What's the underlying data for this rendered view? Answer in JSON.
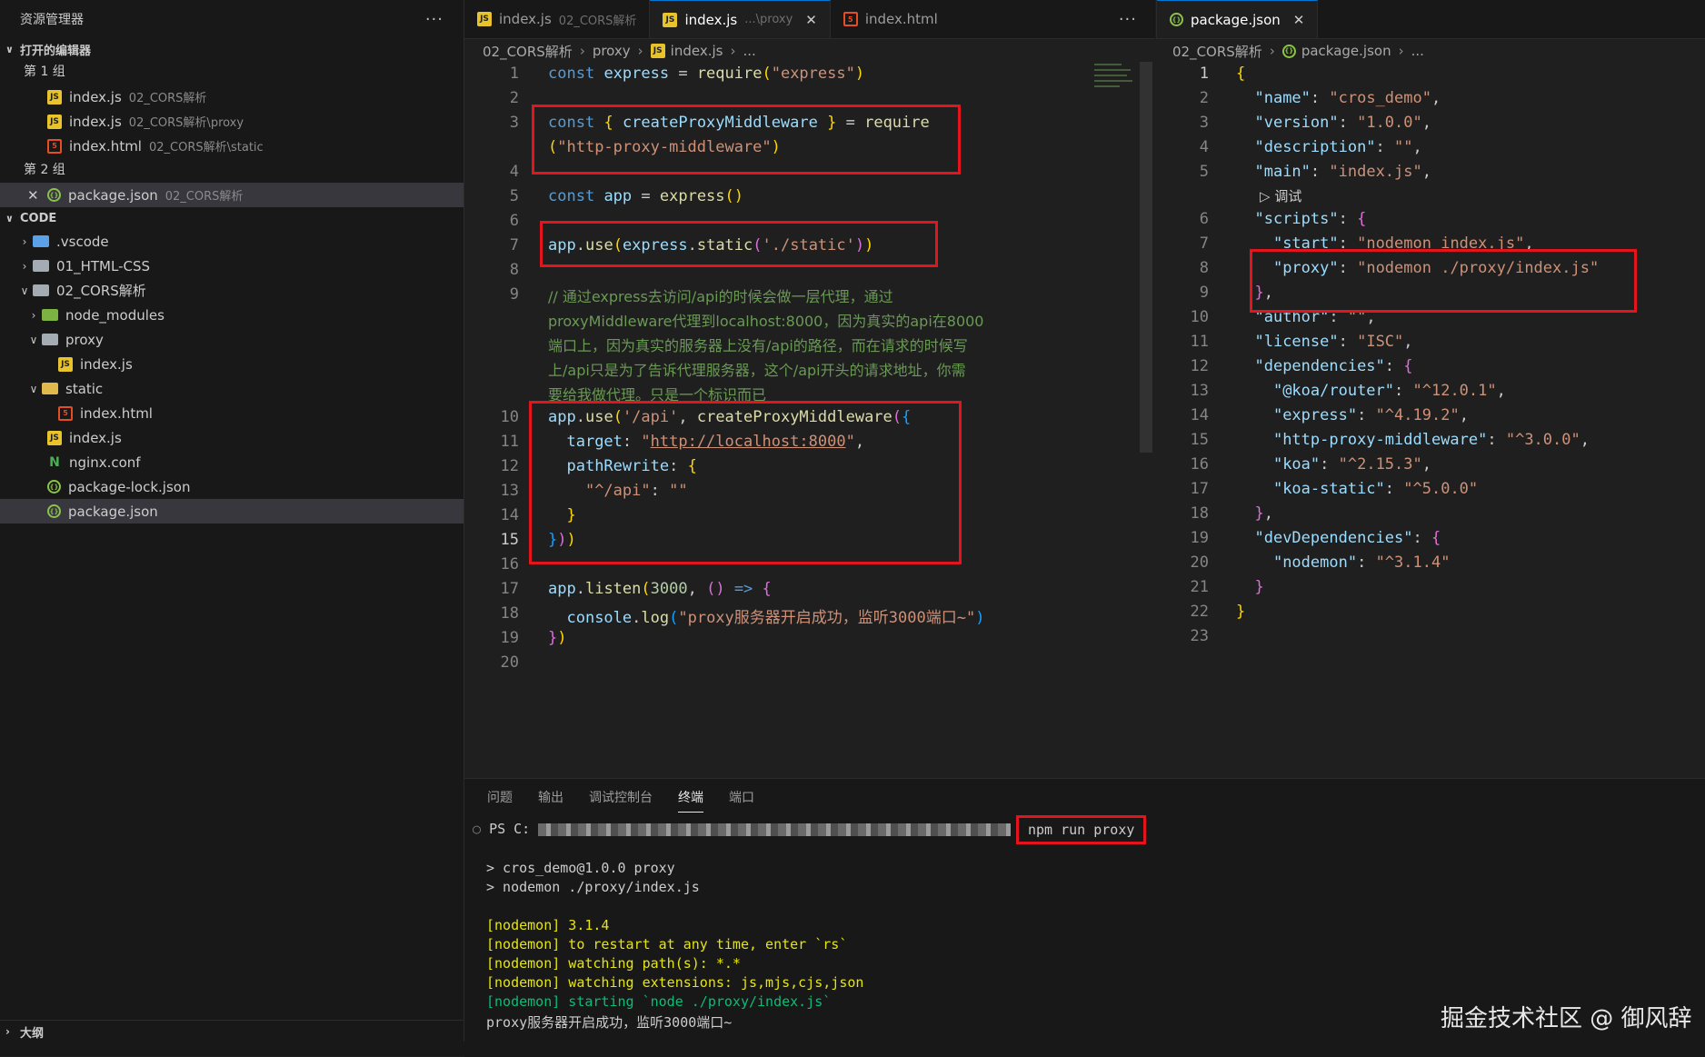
{
  "explorer": {
    "title": "资源管理器",
    "more": "···",
    "open_editors": {
      "header": "打开的编辑器",
      "group1_label": "第 1 组",
      "group1_items": [
        {
          "name": "index.js",
          "desc": "02_CORS解析",
          "icon": "js-file-icon"
        },
        {
          "name": "index.js",
          "desc": "02_CORS解析\\proxy",
          "icon": "js-file-icon"
        },
        {
          "name": "index.html",
          "desc": "02_CORS解析\\static",
          "icon": "html-file-icon"
        }
      ],
      "group2_label": "第 2 组",
      "group2_items": [
        {
          "name": "package.json",
          "desc": "02_CORS解析",
          "icon": "json-file-icon"
        }
      ]
    },
    "workspace": {
      "header": "CODE",
      "tree": [
        {
          "label": ".vscode"
        },
        {
          "label": "01_HTML-CSS"
        },
        {
          "label": "02_CORS解析"
        },
        {
          "label": "node_modules"
        },
        {
          "label": "proxy"
        },
        {
          "label": "index.js"
        },
        {
          "label": "static"
        },
        {
          "label": "index.html"
        },
        {
          "label": "index.js"
        },
        {
          "label": "nginx.conf"
        },
        {
          "label": "package-lock.json"
        },
        {
          "label": "package.json"
        }
      ]
    },
    "outline_header": "大纲"
  },
  "left_editor": {
    "tabs": [
      {
        "name": "index.js",
        "desc": "02_CORS解析"
      },
      {
        "name": "index.js",
        "desc": "...\\proxy",
        "close": "✕"
      },
      {
        "name": "index.html",
        "desc": ""
      }
    ],
    "more": "···",
    "breadcrumb": [
      "02_CORS解析",
      "proxy",
      "index.js",
      "..."
    ],
    "line_numbers": [
      "1",
      "2",
      "3",
      "4",
      "5",
      "6",
      "7",
      "8",
      "9",
      "10",
      "11",
      "12",
      "13",
      "14",
      "15",
      "16",
      "17",
      "18",
      "19",
      "20"
    ],
    "comment_lines": [
      "// 通过express去访问/api的时候会做一层代理，通过",
      "proxyMiddleware代理到localhost:8000，因为真实的api在8000",
      "端口上，因为真实的服务器上没有/api的路径，而在请求的时候写",
      "上/api只是为了告诉代理服务器，这个/api开头的请求地址，你需",
      "要给我做代理。只是一个标识而已"
    ],
    "url": "http://localhost:8000"
  },
  "right_editor": {
    "tab": {
      "name": "package.json",
      "close": "✕"
    },
    "breadcrumb": [
      "02_CORS解析",
      "package.json",
      "..."
    ],
    "debug_label": "调试",
    "line_numbers": [
      "1",
      "2",
      "3",
      "4",
      "5",
      "6",
      "7",
      "8",
      "9",
      "10",
      "11",
      "12",
      "13",
      "14",
      "15",
      "16",
      "17",
      "18",
      "19",
      "20",
      "21",
      "22",
      "23"
    ]
  },
  "panel": {
    "tabs": [
      "问题",
      "输出",
      "调试控制台",
      "终端",
      "端口"
    ],
    "active_tab": "终端",
    "prompt": "PS C:",
    "command": "npm run proxy",
    "output": [
      {
        "text": "> cros_demo@1.0.0 proxy",
        "color": "white"
      },
      {
        "text": "> nodemon ./proxy/index.js",
        "color": "white"
      },
      {
        "text": "",
        "color": "white"
      },
      {
        "text": "[nodemon] 3.1.4",
        "color": "yellow"
      },
      {
        "text": "[nodemon] to restart at any time, enter `rs`",
        "color": "yellow"
      },
      {
        "text": "[nodemon] watching path(s): *.*",
        "color": "yellow"
      },
      {
        "text": "[nodemon] watching extensions: js,mjs,cjs,json",
        "color": "yellow"
      },
      {
        "text": "[nodemon] starting `node ./proxy/index.js`",
        "color": "green"
      },
      {
        "text": "proxy服务器开启成功，监听3000端口~",
        "color": "white"
      }
    ]
  },
  "watermark": "掘金技术社区 @ 御风辞",
  "colors": {
    "highlight_box": "#e3141b",
    "accent": "#0078d4"
  }
}
